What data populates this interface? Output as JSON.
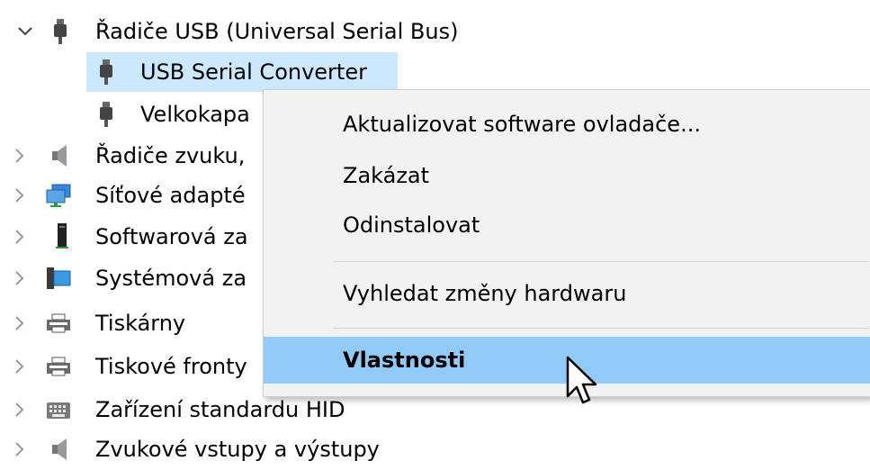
{
  "tree": {
    "usb_controllers": {
      "label": "Řadiče USB (Universal Serial Bus)",
      "icon": "usb-plug-icon",
      "expanded": true
    },
    "usb_serial_converter": {
      "label": "USB Serial Converter",
      "icon": "usb-plug-icon",
      "selected": true
    },
    "mass_storage": {
      "label": "Velkokapa",
      "icon": "usb-plug-icon"
    },
    "collapsed_items": [
      {
        "label": "Řadiče zvuku,",
        "icon": "speaker-icon"
      },
      {
        "label": "Síťové adapté",
        "icon": "network-adapter-icon"
      },
      {
        "label": "Softwarová za",
        "icon": "software-device-icon"
      },
      {
        "label": "Systémová za",
        "icon": "system-device-icon"
      },
      {
        "label": "Tiskárny",
        "icon": "printer-icon"
      },
      {
        "label": "Tiskové fronty",
        "icon": "printer-icon"
      },
      {
        "label": "Zařízení standardu HID",
        "icon": "hid-keyboard-icon"
      },
      {
        "label": "Zvukové vstupy a výstupy",
        "icon": "speaker-icon"
      }
    ]
  },
  "context_menu": {
    "update_driver": "Aktualizovat software ovladače...",
    "disable": "Zakázat",
    "uninstall": "Odinstalovat",
    "scan_hardware": "Vyhledat změny hardwaru",
    "properties": "Vlastnosti"
  },
  "colors": {
    "selection": "#cce8ff",
    "menu_highlight": "#91c9f7",
    "menu_background": "#f2f2f2"
  }
}
